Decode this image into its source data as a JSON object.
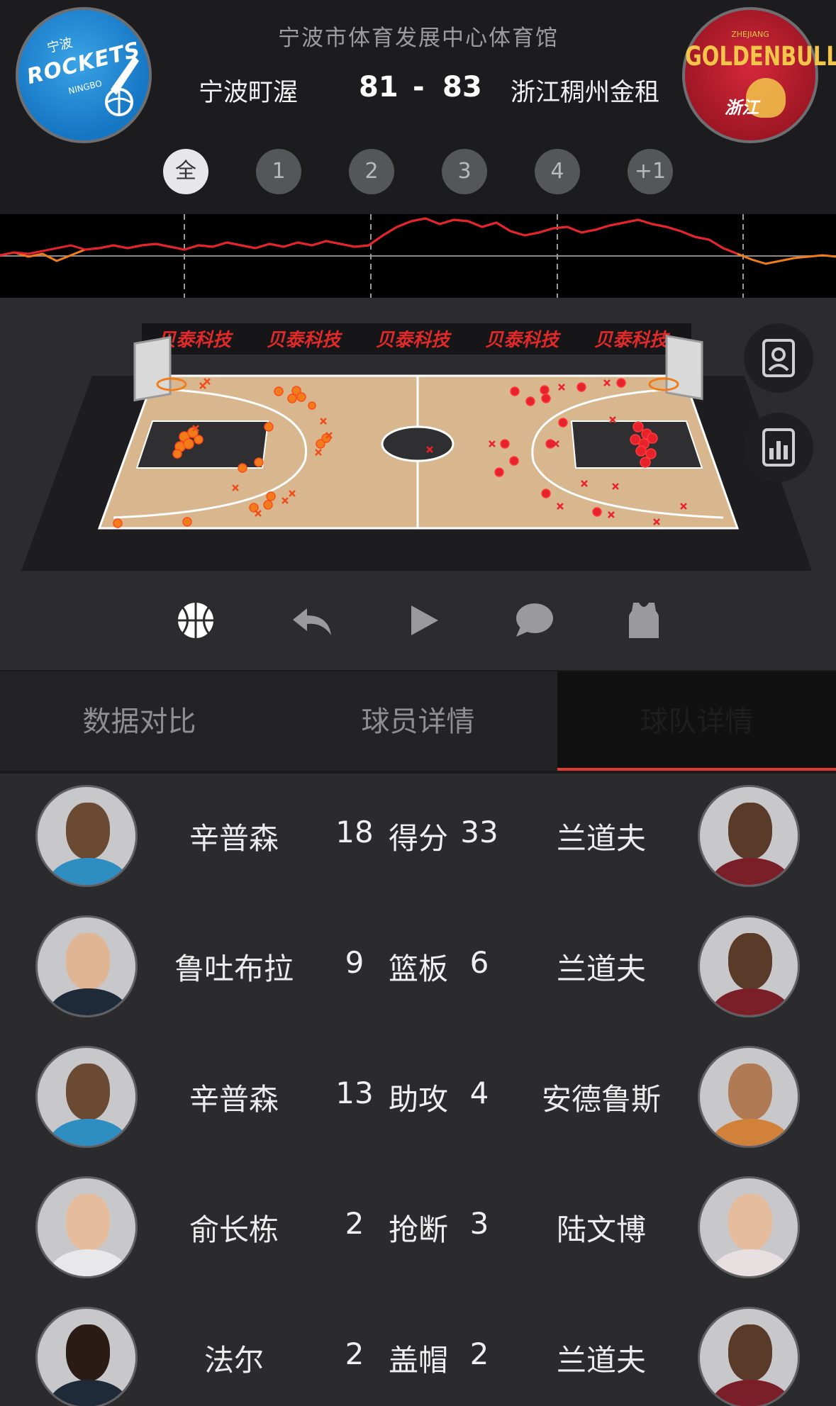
{
  "header": {
    "venue": "宁波市体育发展中心体育馆",
    "home_team": "宁波町渥",
    "away_team": "浙江稠州金租",
    "home_score": "81",
    "score_separator": "-",
    "away_score": "83",
    "home_logo": {
      "line1": "ROCKETS",
      "line2": "宁波",
      "line3": "NINGBO",
      "color": "#1e88d8"
    },
    "away_logo": {
      "line1": "GOLDENBULLS",
      "line2": "ZHEJIANG",
      "line3": "浙江",
      "color": "#c01f2f"
    }
  },
  "periods": [
    "全",
    "1",
    "2",
    "3",
    "4",
    "+1"
  ],
  "active_period": "全",
  "court": {
    "sponsor_text": "贝泰科技",
    "sponsor_boards": [
      "贝泰科技",
      "贝泰科技",
      "贝泰科技",
      "贝泰科技",
      "贝泰科技"
    ],
    "home_shot_color": "#f07c1a",
    "away_shot_color": "#e8222d"
  },
  "side_buttons": [
    {
      "icon": "player-card-icon"
    },
    {
      "icon": "stats-chart-icon"
    }
  ],
  "controls": [
    {
      "icon": "basketball-icon"
    },
    {
      "icon": "undo-arrow-icon"
    },
    {
      "icon": "play-icon"
    },
    {
      "icon": "comment-icon"
    },
    {
      "icon": "jersey-icon"
    }
  ],
  "tabs": [
    {
      "label": "数据对比"
    },
    {
      "label": "球员详情"
    },
    {
      "label": "球队详情"
    }
  ],
  "active_tab": 2,
  "leaders": [
    {
      "category": "得分",
      "left_player": "辛普森",
      "left_value": "18",
      "right_value": "33",
      "right_player": "兰道夫"
    },
    {
      "category": "篮板",
      "left_player": "鲁吐布拉",
      "left_value": "9",
      "right_value": "6",
      "right_player": "兰道夫"
    },
    {
      "category": "助攻",
      "left_player": "辛普森",
      "left_value": "13",
      "right_value": "4",
      "right_player": "安德鲁斯"
    },
    {
      "category": "抢断",
      "left_player": "俞长栋",
      "left_value": "2",
      "right_value": "3",
      "right_player": "陆文博"
    },
    {
      "category": "盖帽",
      "left_player": "法尔",
      "left_value": "2",
      "right_value": "2",
      "right_player": "兰道夫"
    }
  ],
  "colors": {
    "accent": "#e23b34",
    "trend_home": "#e8222d",
    "trend_away": "#f07c1a"
  }
}
